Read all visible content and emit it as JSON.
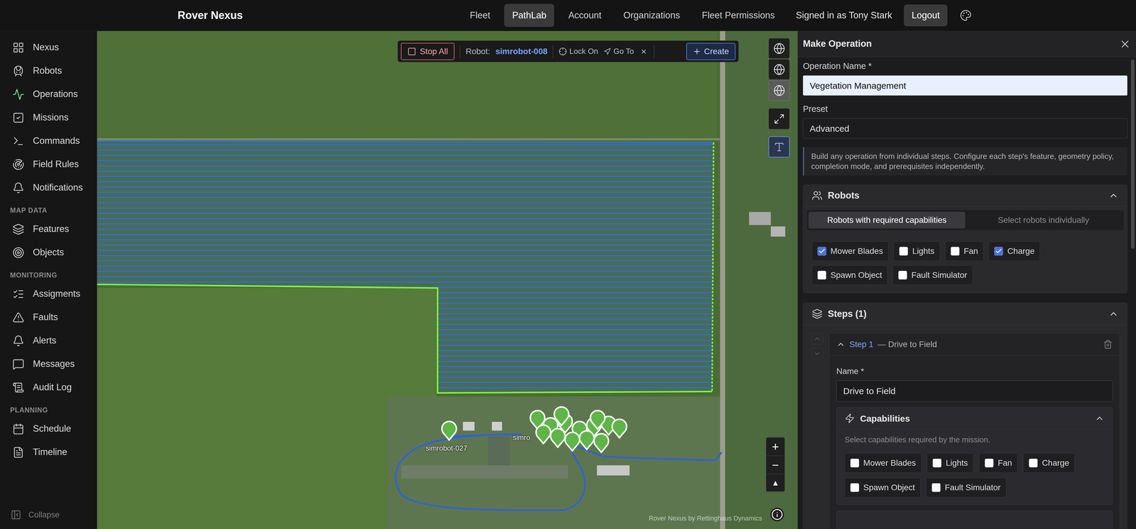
{
  "topbar": {
    "brand": "Rover Nexus",
    "nav": [
      {
        "label": "Fleet",
        "selected": false
      },
      {
        "label": "PathLab",
        "selected": true
      },
      {
        "label": "Account",
        "selected": false
      },
      {
        "label": "Organizations",
        "selected": false
      },
      {
        "label": "Fleet Permissions",
        "selected": false
      }
    ],
    "user": "Signed in as Tony Stark",
    "logout": "Logout"
  },
  "sidebar": {
    "sections": [
      {
        "items": [
          {
            "label": "Nexus",
            "selected": false
          },
          {
            "label": "Robots",
            "selected": false
          },
          {
            "label": "Operations",
            "selected": true
          },
          {
            "label": "Missions",
            "selected": false
          },
          {
            "label": "Commands",
            "selected": false
          },
          {
            "label": "Field Rules",
            "selected": false
          },
          {
            "label": "Notifications",
            "selected": false
          }
        ]
      },
      {
        "title": "MAP DATA",
        "items": [
          {
            "label": "Features",
            "selected": false
          },
          {
            "label": "Objects",
            "selected": false
          }
        ]
      },
      {
        "title": "MONITORING",
        "items": [
          {
            "label": "Assigments",
            "selected": false
          },
          {
            "label": "Faults",
            "selected": false
          },
          {
            "label": "Alerts",
            "selected": false
          },
          {
            "label": "Messages",
            "selected": false
          },
          {
            "label": "Audit Log",
            "selected": false
          }
        ]
      },
      {
        "title": "PLANNING",
        "items": [
          {
            "label": "Schedule",
            "selected": false
          },
          {
            "label": "Timeline",
            "selected": false
          }
        ]
      }
    ],
    "collapse": "Collapse"
  },
  "map": {
    "toolbar": {
      "stop_all": "Stop All",
      "robot_label": "Robot:",
      "robot": "simrobot-008",
      "lock_on": "Lock On",
      "go_to": "Go To",
      "close": "×",
      "create": "Create"
    },
    "layer_buttons": [
      {
        "selected": false
      },
      {
        "selected": false
      },
      {
        "selected": true
      }
    ],
    "text_tool": {
      "selected": true
    },
    "zoom_in": "+",
    "zoom_out": "−",
    "north": "▲",
    "robots": [
      {
        "label": "simrobot-027"
      },
      {
        "label": "simro"
      }
    ],
    "attribution": "Rover Nexus by Rettinghaus Dynamics"
  },
  "panel": {
    "title": "Make Operation",
    "operation_name": {
      "label": "Operation Name *",
      "value": "Vegetation Management"
    },
    "preset": {
      "label": "Preset",
      "value": "Advanced"
    },
    "info": "Build any operation from individual steps. Configure each step's feature, geometry policy, completion mode, and prerequisites independently.",
    "robots": {
      "title": "Robots",
      "expanded": true,
      "modes": [
        {
          "label": "Robots with required capabilities",
          "selected": true
        },
        {
          "label": "Select robots individually",
          "selected": false
        }
      ],
      "capabilities": [
        {
          "label": "Mower Blades",
          "checked": true
        },
        {
          "label": "Lights",
          "checked": false
        },
        {
          "label": "Fan",
          "checked": false
        },
        {
          "label": "Charge",
          "checked": true
        },
        {
          "label": "Spawn Object",
          "checked": false
        },
        {
          "label": "Fault Simulator",
          "checked": false
        }
      ]
    },
    "steps": {
      "title": "Steps (1)",
      "expanded": true,
      "items": [
        {
          "label": "Step 1",
          "subtitle": "— Drive to Field",
          "expanded": true,
          "name_label": "Name *",
          "name": "Drive to Field",
          "capabilities": {
            "title": "Capabilities",
            "expanded": true,
            "hint": "Select capabilities required by the mission.",
            "items": [
              {
                "label": "Mower Blades",
                "checked": false
              },
              {
                "label": "Lights",
                "checked": false
              },
              {
                "label": "Fan",
                "checked": false
              },
              {
                "label": "Charge",
                "checked": false
              },
              {
                "label": "Spawn Object",
                "checked": false
              },
              {
                "label": "Fault Simulator",
                "checked": false
              }
            ]
          }
        }
      ]
    }
  }
}
